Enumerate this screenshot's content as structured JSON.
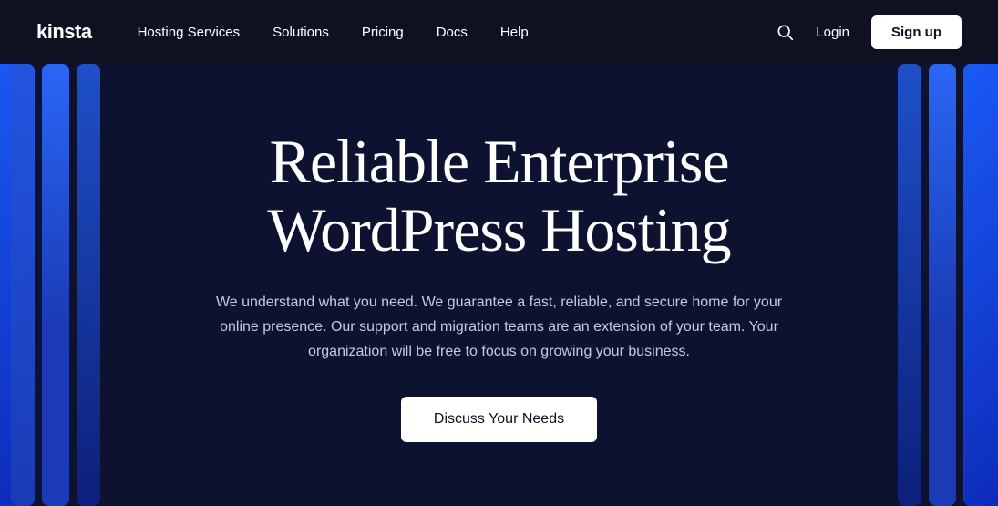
{
  "brand": {
    "logo_text": "kinsta"
  },
  "navbar": {
    "links": [
      {
        "id": "hosting-services",
        "label": "Hosting Services"
      },
      {
        "id": "solutions",
        "label": "Solutions"
      },
      {
        "id": "pricing",
        "label": "Pricing"
      },
      {
        "id": "docs",
        "label": "Docs"
      },
      {
        "id": "help",
        "label": "Help"
      }
    ],
    "login_label": "Login",
    "signup_label": "Sign up"
  },
  "hero": {
    "title_line1": "Reliable Enterprise",
    "title_line2": "WordPress Hosting",
    "subtitle": "We understand what you need. We guarantee a fast, reliable, and secure home for your online presence. Our support and migration teams are an extension of your team. Your organization will be free to focus on growing your business.",
    "cta_label": "Discuss Your Needs"
  }
}
